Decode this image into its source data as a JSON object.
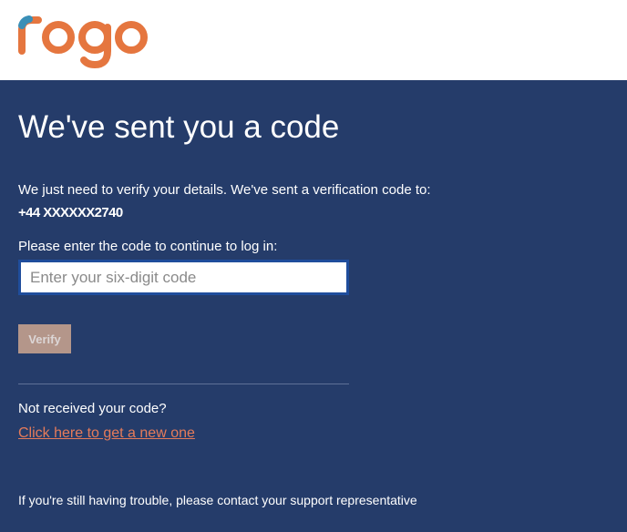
{
  "brand": {
    "logo_text": "rogo",
    "logo_color": "#e5763f",
    "logo_accent_colors": [
      "#e5763f",
      "#3a8fb7"
    ]
  },
  "colors": {
    "page_background": "#253c6a",
    "header_background": "#ffffff",
    "link": "#e57b5a",
    "button_disabled_bg": "#b4968a",
    "input_border": "#1f4d9c"
  },
  "verify": {
    "title": "We've sent you a code",
    "intro": "We just need to verify your details. We've sent a verification code to:",
    "phone": "+44 XXXXXX2740",
    "prompt": "Please enter the code to continue to log in:",
    "code_placeholder": "Enter your six-digit code",
    "code_value": "",
    "verify_label": "Verify",
    "verify_disabled": true
  },
  "resend": {
    "question": "Not received your code?",
    "link_label": "Click here to get a new one"
  },
  "support": {
    "text": "If you're still having trouble, please contact your support representative"
  }
}
